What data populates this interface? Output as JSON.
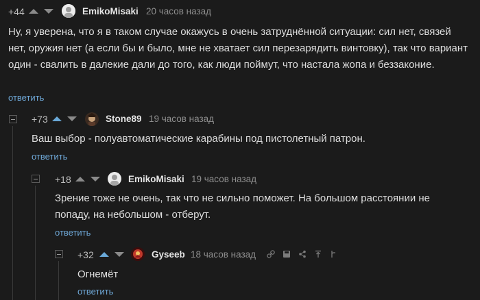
{
  "comments": [
    {
      "score": "+44",
      "username": "EmikoMisaki",
      "time": "20 часов назад",
      "text": "Ну, я уверена, что я в таком случае окажусь в очень затруднённой ситуации: сил нет, связей нет, оружия нет (а если бы и было, мне не хватает сил перезарядить винтовку), так что вариант один - свалить в далекие дали до того, как люди поймут, что настала жопа и беззаконие.",
      "reply_label": "ответить"
    },
    {
      "score": "+73",
      "username": "Stone89",
      "time": "19 часов назад",
      "text": "Ваш выбор - полуавтоматические карабины под пистолетный патрон.",
      "reply_label": "ответить"
    },
    {
      "score": "+18",
      "username": "EmikoMisaki",
      "time": "19 часов назад",
      "text": "Зрение тоже не очень, так что не сильно поможет. На большом расстоянии не попаду, на небольшом - отберут.",
      "reply_label": "ответить"
    },
    {
      "score": "+32",
      "username": "Gyseeb",
      "time": "18 часов назад",
      "text": "Огнемёт",
      "reply_label": "ответить",
      "toolbar_icons": [
        "link-icon",
        "save-icon",
        "share-icon",
        "top-icon",
        "branch-icon"
      ]
    }
  ],
  "colors": {
    "background": "#1b1b1b",
    "link": "#6ea7d6",
    "upvote_active": "#6aa9d8"
  }
}
